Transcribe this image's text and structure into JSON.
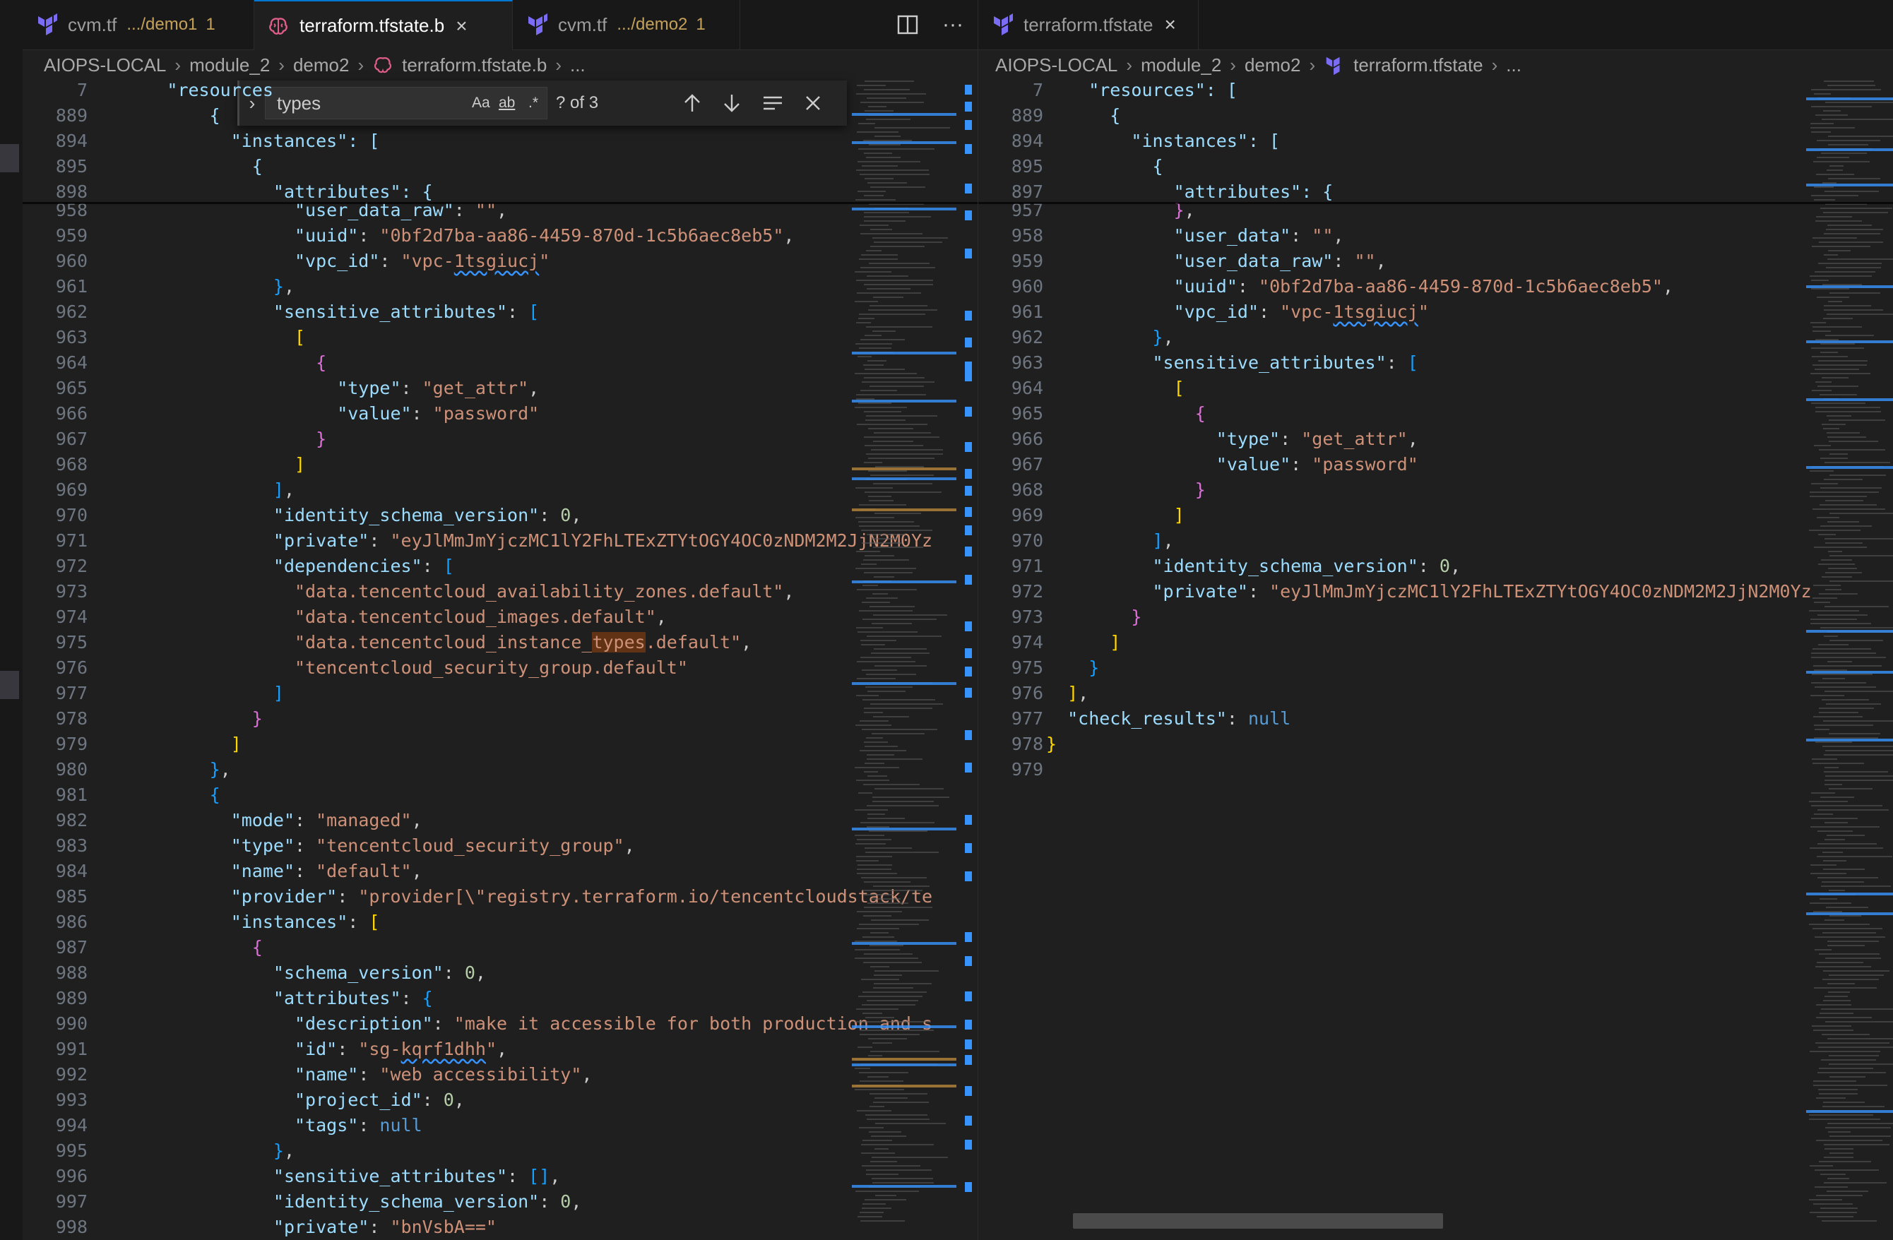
{
  "left_pane": {
    "tabs": [
      {
        "icon": "terraform-icon",
        "label": "cvm.tf",
        "path": ".../demo1",
        "badge": "1",
        "active": false
      },
      {
        "icon": "brain-icon",
        "label": "terraform.tfstate.b",
        "active": true,
        "close": "×"
      },
      {
        "icon": "terraform-icon",
        "label": "cvm.tf",
        "path": ".../demo2",
        "badge": "1",
        "active": false
      }
    ],
    "actions": {
      "split": "split-editor-icon",
      "more": "···"
    },
    "breadcrumb": [
      "AIOPS-LOCAL",
      "module_2",
      "demo2",
      "terraform.tfstate.b",
      "..."
    ],
    "find": {
      "query": "types",
      "case": "Aa",
      "word": "ab",
      "regex": ".*",
      "count": "? of 3"
    },
    "sticky_lines": [
      {
        "n": "7",
        "text": "\"resources"
      },
      {
        "n": "889",
        "text": "{"
      },
      {
        "n": "894",
        "text": "\"instances\": ["
      },
      {
        "n": "895",
        "text": "{"
      },
      {
        "n": "898",
        "text": "\"attributes\": {"
      }
    ],
    "lines": [
      {
        "n": "958",
        "tokens": [
          [
            "k",
            "\"user_data_raw\""
          ],
          [
            "p",
            ": "
          ],
          [
            "s",
            "\"\""
          ],
          [
            "p",
            ","
          ]
        ]
      },
      {
        "n": "959",
        "tokens": [
          [
            "k",
            "\"uuid\""
          ],
          [
            "p",
            ": "
          ],
          [
            "s",
            "\"0bf2d7ba-aa86-4459-870d-1c5b6aec8eb5\""
          ],
          [
            "p",
            ","
          ]
        ]
      },
      {
        "n": "960",
        "tokens": [
          [
            "k",
            "\"vpc_id\""
          ],
          [
            "p",
            ": "
          ],
          [
            "s",
            "\"vpc-"
          ],
          [
            "sq",
            "1tsgiucj"
          ],
          [
            "s",
            "\""
          ]
        ]
      },
      {
        "n": "961",
        "tokens": [
          [
            "b3",
            "}"
          ],
          [
            "p",
            ","
          ]
        ]
      },
      {
        "n": "962",
        "tokens": [
          [
            "k",
            "\"sensitive_attributes\""
          ],
          [
            "p",
            ": "
          ],
          [
            "b3",
            "["
          ]
        ]
      },
      {
        "n": "963",
        "tokens": [
          [
            "b1",
            "["
          ]
        ]
      },
      {
        "n": "964",
        "tokens": [
          [
            "b2",
            "{"
          ]
        ]
      },
      {
        "n": "965",
        "tokens": [
          [
            "k",
            "\"type\""
          ],
          [
            "p",
            ": "
          ],
          [
            "s",
            "\"get_attr\""
          ],
          [
            "p",
            ","
          ]
        ]
      },
      {
        "n": "966",
        "tokens": [
          [
            "k",
            "\"value\""
          ],
          [
            "p",
            ": "
          ],
          [
            "s",
            "\"password\""
          ]
        ]
      },
      {
        "n": "967",
        "tokens": [
          [
            "b2",
            "}"
          ]
        ]
      },
      {
        "n": "968",
        "tokens": [
          [
            "b1",
            "]"
          ]
        ]
      },
      {
        "n": "969",
        "tokens": [
          [
            "b3",
            "]"
          ],
          [
            "p",
            ","
          ]
        ]
      },
      {
        "n": "970",
        "tokens": [
          [
            "k",
            "\"identity_schema_version\""
          ],
          [
            "p",
            ": "
          ],
          [
            "n",
            "0"
          ],
          [
            "p",
            ","
          ]
        ]
      },
      {
        "n": "971",
        "tokens": [
          [
            "k",
            "\"private\""
          ],
          [
            "p",
            ": "
          ],
          [
            "s",
            "\"eyJlMmJmYjczMC1lY2FhLTExZTYtOGY4OC0zNDM2M2JjN2M0Yz"
          ]
        ]
      },
      {
        "n": "972",
        "tokens": [
          [
            "k",
            "\"dependencies\""
          ],
          [
            "p",
            ": "
          ],
          [
            "b3",
            "["
          ]
        ]
      },
      {
        "n": "973",
        "tokens": [
          [
            "s",
            "\"data.tencentcloud_availability_zones.default\""
          ],
          [
            "p",
            ","
          ]
        ]
      },
      {
        "n": "974",
        "tokens": [
          [
            "s",
            "\"data.tencentcloud_images.default\""
          ],
          [
            "p",
            ","
          ]
        ]
      },
      {
        "n": "975",
        "tokens": [
          [
            "s",
            "\"data.tencentcloud_instance_"
          ],
          [
            "hl",
            "types"
          ],
          [
            "s",
            ".default\""
          ],
          [
            "p",
            ","
          ]
        ]
      },
      {
        "n": "976",
        "tokens": [
          [
            "s",
            "\"tencentcloud_security_group.default\""
          ]
        ]
      },
      {
        "n": "977",
        "tokens": [
          [
            "b3",
            "]"
          ]
        ]
      },
      {
        "n": "978",
        "tokens": [
          [
            "b2",
            "}"
          ]
        ]
      },
      {
        "n": "979",
        "tokens": [
          [
            "b1",
            "]"
          ]
        ]
      },
      {
        "n": "980",
        "tokens": [
          [
            "b3",
            "}"
          ],
          [
            "p",
            ","
          ]
        ]
      },
      {
        "n": "981",
        "tokens": [
          [
            "b3",
            "{"
          ]
        ]
      },
      {
        "n": "982",
        "tokens": [
          [
            "k",
            "\"mode\""
          ],
          [
            "p",
            ": "
          ],
          [
            "s",
            "\"managed\""
          ],
          [
            "p",
            ","
          ]
        ]
      },
      {
        "n": "983",
        "tokens": [
          [
            "k",
            "\"type\""
          ],
          [
            "p",
            ": "
          ],
          [
            "s",
            "\"tencentcloud_security_group\""
          ],
          [
            "p",
            ","
          ]
        ]
      },
      {
        "n": "984",
        "tokens": [
          [
            "k",
            "\"name\""
          ],
          [
            "p",
            ": "
          ],
          [
            "s",
            "\"default\""
          ],
          [
            "p",
            ","
          ]
        ]
      },
      {
        "n": "985",
        "tokens": [
          [
            "k",
            "\"provider\""
          ],
          [
            "p",
            ": "
          ],
          [
            "s",
            "\"provider[\\\"registry.terraform.io/tencentcloudstack/te"
          ]
        ]
      },
      {
        "n": "986",
        "tokens": [
          [
            "k",
            "\"instances\""
          ],
          [
            "p",
            ": "
          ],
          [
            "b1",
            "["
          ]
        ]
      },
      {
        "n": "987",
        "tokens": [
          [
            "b2",
            "{"
          ]
        ]
      },
      {
        "n": "988",
        "tokens": [
          [
            "k",
            "\"schema_version\""
          ],
          [
            "p",
            ": "
          ],
          [
            "n",
            "0"
          ],
          [
            "p",
            ","
          ]
        ]
      },
      {
        "n": "989",
        "tokens": [
          [
            "k",
            "\"attributes\""
          ],
          [
            "p",
            ": "
          ],
          [
            "b3",
            "{"
          ]
        ]
      },
      {
        "n": "990",
        "tokens": [
          [
            "k",
            "\"description\""
          ],
          [
            "p",
            ": "
          ],
          [
            "s",
            "\"make it accessible for both production and s"
          ]
        ]
      },
      {
        "n": "991",
        "tokens": [
          [
            "k",
            "\"id\""
          ],
          [
            "p",
            ": "
          ],
          [
            "s",
            "\"sg-"
          ],
          [
            "sq",
            "kqrf1dhh"
          ],
          [
            "s",
            "\""
          ],
          [
            "p",
            ","
          ]
        ]
      },
      {
        "n": "992",
        "tokens": [
          [
            "k",
            "\"name\""
          ],
          [
            "p",
            ": "
          ],
          [
            "s",
            "\"web accessibility\""
          ],
          [
            "p",
            ","
          ]
        ]
      },
      {
        "n": "993",
        "tokens": [
          [
            "k",
            "\"project_id\""
          ],
          [
            "p",
            ": "
          ],
          [
            "n",
            "0"
          ],
          [
            "p",
            ","
          ]
        ]
      },
      {
        "n": "994",
        "tokens": [
          [
            "k",
            "\"tags\""
          ],
          [
            "p",
            ": "
          ],
          [
            "kw",
            "null"
          ]
        ]
      },
      {
        "n": "995",
        "tokens": [
          [
            "b3",
            "}"
          ],
          [
            "p",
            ","
          ]
        ]
      },
      {
        "n": "996",
        "tokens": [
          [
            "k",
            "\"sensitive_attributes\""
          ],
          [
            "p",
            ": "
          ],
          [
            "b3",
            "[]"
          ],
          [
            "p",
            ","
          ]
        ]
      },
      {
        "n": "997",
        "tokens": [
          [
            "k",
            "\"identity_schema_version\""
          ],
          [
            "p",
            ": "
          ],
          [
            "n",
            "0"
          ],
          [
            "p",
            ","
          ]
        ]
      },
      {
        "n": "998",
        "tokens": [
          [
            "k",
            "\"private\""
          ],
          [
            "p",
            ": "
          ],
          [
            "s",
            "\"bnVsbA==\""
          ]
        ]
      }
    ]
  },
  "right_pane": {
    "tabs": [
      {
        "icon": "terraform-icon",
        "label": "terraform.tfstate",
        "active": false,
        "close": "×"
      }
    ],
    "breadcrumb": [
      "AIOPS-LOCAL",
      "module_2",
      "demo2",
      "terraform.tfstate",
      "..."
    ],
    "sticky_lines": [
      {
        "n": "7",
        "text": "\"resources\": ["
      },
      {
        "n": "889",
        "text": "{"
      },
      {
        "n": "894",
        "text": "\"instances\": ["
      },
      {
        "n": "895",
        "text": "{"
      },
      {
        "n": "897",
        "text": "\"attributes\": {"
      }
    ],
    "lines": [
      {
        "n": "957",
        "tokens": [
          [
            "b2",
            "}"
          ],
          [
            "p",
            ","
          ]
        ]
      },
      {
        "n": "958",
        "tokens": [
          [
            "k",
            "\"user_data\""
          ],
          [
            "p",
            ": "
          ],
          [
            "s",
            "\"\""
          ],
          [
            "p",
            ","
          ]
        ]
      },
      {
        "n": "959",
        "tokens": [
          [
            "k",
            "\"user_data_raw\""
          ],
          [
            "p",
            ": "
          ],
          [
            "s",
            "\"\""
          ],
          [
            "p",
            ","
          ]
        ]
      },
      {
        "n": "960",
        "tokens": [
          [
            "k",
            "\"uuid\""
          ],
          [
            "p",
            ": "
          ],
          [
            "s",
            "\"0bf2d7ba-aa86-4459-870d-1c5b6aec8eb5\""
          ],
          [
            "p",
            ","
          ]
        ]
      },
      {
        "n": "961",
        "tokens": [
          [
            "k",
            "\"vpc_id\""
          ],
          [
            "p",
            ": "
          ],
          [
            "s",
            "\"vpc-"
          ],
          [
            "sq",
            "1tsgiucj"
          ],
          [
            "s",
            "\""
          ]
        ]
      },
      {
        "n": "962",
        "tokens": [
          [
            "b3",
            "}"
          ],
          [
            "p",
            ","
          ]
        ]
      },
      {
        "n": "963",
        "tokens": [
          [
            "k",
            "\"sensitive_attributes\""
          ],
          [
            "p",
            ": "
          ],
          [
            "b3",
            "["
          ]
        ]
      },
      {
        "n": "964",
        "tokens": [
          [
            "b1",
            "["
          ]
        ]
      },
      {
        "n": "965",
        "tokens": [
          [
            "b2",
            "{"
          ]
        ]
      },
      {
        "n": "966",
        "tokens": [
          [
            "k",
            "\"type\""
          ],
          [
            "p",
            ": "
          ],
          [
            "s",
            "\"get_attr\""
          ],
          [
            "p",
            ","
          ]
        ]
      },
      {
        "n": "967",
        "tokens": [
          [
            "k",
            "\"value\""
          ],
          [
            "p",
            ": "
          ],
          [
            "s",
            "\"password\""
          ]
        ]
      },
      {
        "n": "968",
        "tokens": [
          [
            "b2",
            "}"
          ]
        ]
      },
      {
        "n": "969",
        "tokens": [
          [
            "b1",
            "]"
          ]
        ]
      },
      {
        "n": "970",
        "tokens": [
          [
            "b3",
            "]"
          ],
          [
            "p",
            ","
          ]
        ]
      },
      {
        "n": "971",
        "tokens": [
          [
            "k",
            "\"identity_schema_version\""
          ],
          [
            "p",
            ": "
          ],
          [
            "n",
            "0"
          ],
          [
            "p",
            ","
          ]
        ]
      },
      {
        "n": "972",
        "tokens": [
          [
            "k",
            "\"private\""
          ],
          [
            "p",
            ": "
          ],
          [
            "s",
            "\"eyJlMmJmYjczMC1lY2FhLTExZTYtOGY4OC0zNDM2M2JjN2M0Yz"
          ]
        ]
      },
      {
        "n": "973",
        "tokens": [
          [
            "b2",
            "}"
          ]
        ]
      },
      {
        "n": "974",
        "tokens": [
          [
            "b1",
            "]"
          ]
        ]
      },
      {
        "n": "975",
        "tokens": [
          [
            "b3",
            "}"
          ]
        ]
      },
      {
        "n": "976",
        "tokens": [
          [
            "b1",
            "]"
          ],
          [
            "p",
            ","
          ]
        ]
      },
      {
        "n": "977",
        "tokens": [
          [
            "k",
            "\"check_results\""
          ],
          [
            "p",
            ": "
          ],
          [
            "kw",
            "null"
          ]
        ]
      },
      {
        "n": "978",
        "tokens": [
          [
            "b1",
            "}"
          ]
        ]
      },
      {
        "n": "979",
        "tokens": []
      }
    ]
  },
  "colors": {
    "accent": "#0078d4",
    "find_match": "#613214",
    "string": "#ce9178",
    "key": "#9cdcfe",
    "keyword": "#569cd6"
  }
}
